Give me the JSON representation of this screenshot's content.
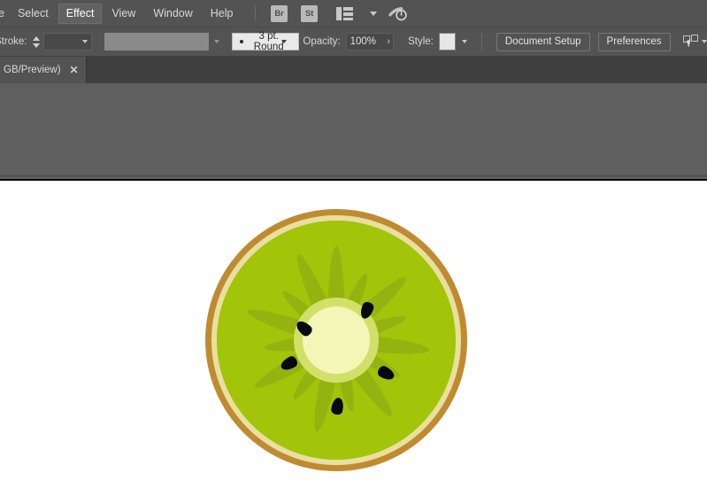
{
  "menubar": {
    "items": [
      {
        "label": "e",
        "state": "cut"
      },
      {
        "label": "Select",
        "state": "normal"
      },
      {
        "label": "Effect",
        "state": "active"
      },
      {
        "label": "View",
        "state": "normal"
      },
      {
        "label": "Window",
        "state": "normal"
      },
      {
        "label": "Help",
        "state": "normal"
      }
    ],
    "bridge_label": "Br",
    "stock_label": "St",
    "arrange_icon": "arrange-documents-icon",
    "arrange_chevron": "chevron-down-icon",
    "search_icon": "search-adobe-icon"
  },
  "optionsbar": {
    "stroke_label": "Stroke:",
    "stroke_weight_value": "",
    "stroke_weight_placeholder": "",
    "stroke_profile_value": "",
    "brush_definition": "3 pt. Round",
    "opacity_label": "Opacity:",
    "opacity_value": "100%",
    "style_label": "Style:",
    "style_swatch_color": "#e6e6e6",
    "document_setup_label": "Document Setup",
    "preferences_label": "Preferences",
    "align_icon": "align-to-selection-icon",
    "align_chevron": "chevron-down-icon"
  },
  "tabbar": {
    "document_title": "GB/Preview)",
    "close_label": "✕"
  },
  "canvas": {
    "artwork_name": "kiwi-fruit-slice",
    "colors": {
      "skin_outer": "#c08b30",
      "skin_inner": "#e8dfa0",
      "flesh": "#a2c409",
      "rays": "#93b410",
      "halo": "#d2e06a",
      "core": "#f4f6b8",
      "seed": "#08080e",
      "canvas_bg": "#ffffff"
    },
    "seed_count": 5
  },
  "theme": {
    "chrome_bg": "#535353",
    "tabbar_bg": "#3f3f3f",
    "workspace_bg": "#5f5f5f",
    "text": "#d8d8d8"
  }
}
